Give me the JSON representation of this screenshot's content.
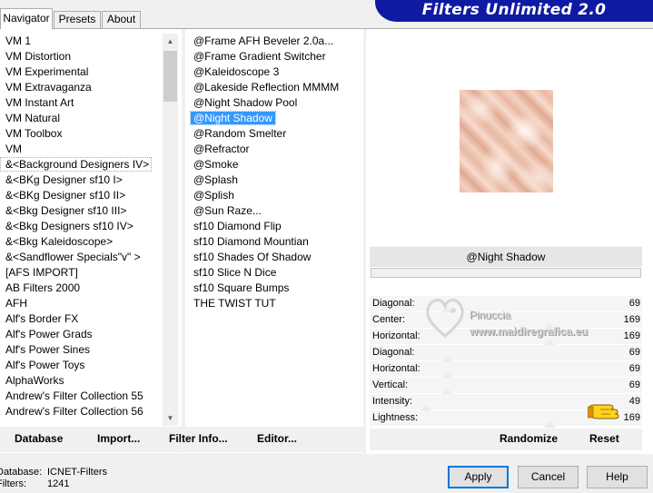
{
  "tabs": [
    "Navigator",
    "Presets",
    "About"
  ],
  "header": {
    "title": "Filters Unlimited 2.0"
  },
  "categories": [
    "VM 1",
    "VM Distortion",
    "VM Experimental",
    "VM Extravaganza",
    "VM Instant Art",
    "VM Natural",
    "VM Toolbox",
    "VM",
    "&<Background Designers IV>",
    "&<BKg Designer sf10 I>",
    "&<BKg Designer sf10 II>",
    "&<Bkg Designer sf10 III>",
    "&<Bkg Designers sf10 IV>",
    "&<Bkg Kaleidoscope>",
    "&<Sandflower Specials\"v\" >",
    "[AFS IMPORT]",
    "AB Filters 2000",
    "AFH",
    "Alf's Border FX",
    "Alf's Power Grads",
    "Alf's Power Sines",
    "Alf's Power Toys",
    "AlphaWorks",
    "Andrew's Filter Collection 55",
    "Andrew's Filter Collection 56"
  ],
  "filters": [
    "@Frame AFH Beveler 2.0a...",
    "@Frame Gradient Switcher",
    "@Kaleidoscope 3",
    "@Lakeside Reflection MMMM",
    "@Night Shadow Pool",
    "@Night Shadow",
    "@Random Smelter",
    "@Refractor",
    "@Smoke",
    "@Splash",
    "@Splish",
    "@Sun Raze...",
    "sf10 Diamond Flip",
    "sf10 Diamond Mountian",
    "sf10 Shades Of Shadow",
    "sf10 Slice N Dice",
    "sf10 Square Bumps",
    "THE TWIST TUT"
  ],
  "selected_filter": "@Night Shadow",
  "progress": 0,
  "sliders": [
    {
      "label": "Diagonal:",
      "value": "69",
      "level": 0.27
    },
    {
      "label": "Center:",
      "value": "169",
      "level": 0.66
    },
    {
      "label": "Horizontal:",
      "value": "169",
      "level": 0.66
    },
    {
      "label": "Diagonal:",
      "value": "69",
      "level": 0.27
    },
    {
      "label": "Horizontal:",
      "value": "69",
      "level": 0.27
    },
    {
      "label": "Vertical:",
      "value": "69",
      "level": 0.27
    },
    {
      "label": "Intensity:",
      "value": "49",
      "level": 0.19
    },
    {
      "label": "Lightness:",
      "value": "169",
      "level": 0.66
    }
  ],
  "watermark": {
    "name": "Pinuccia",
    "url": "www.maidiregrafica.eu"
  },
  "bottom_links": {
    "database": "Database",
    "import": "Import...",
    "filter_info": "Filter Info...",
    "editor": "Editor..."
  },
  "actions": {
    "randomize": "Randomize",
    "reset": "Reset"
  },
  "info": {
    "database_label": "Database:",
    "database_value": "ICNET-Filters",
    "filters_label": "Filters:",
    "filters_value": "1241"
  },
  "buttons": {
    "apply": "Apply",
    "cancel": "Cancel",
    "help": "Help"
  },
  "colors": {
    "header_bg": "#0f1aa3",
    "selection": "#3399ff",
    "default_button_border": "#0078d7"
  }
}
